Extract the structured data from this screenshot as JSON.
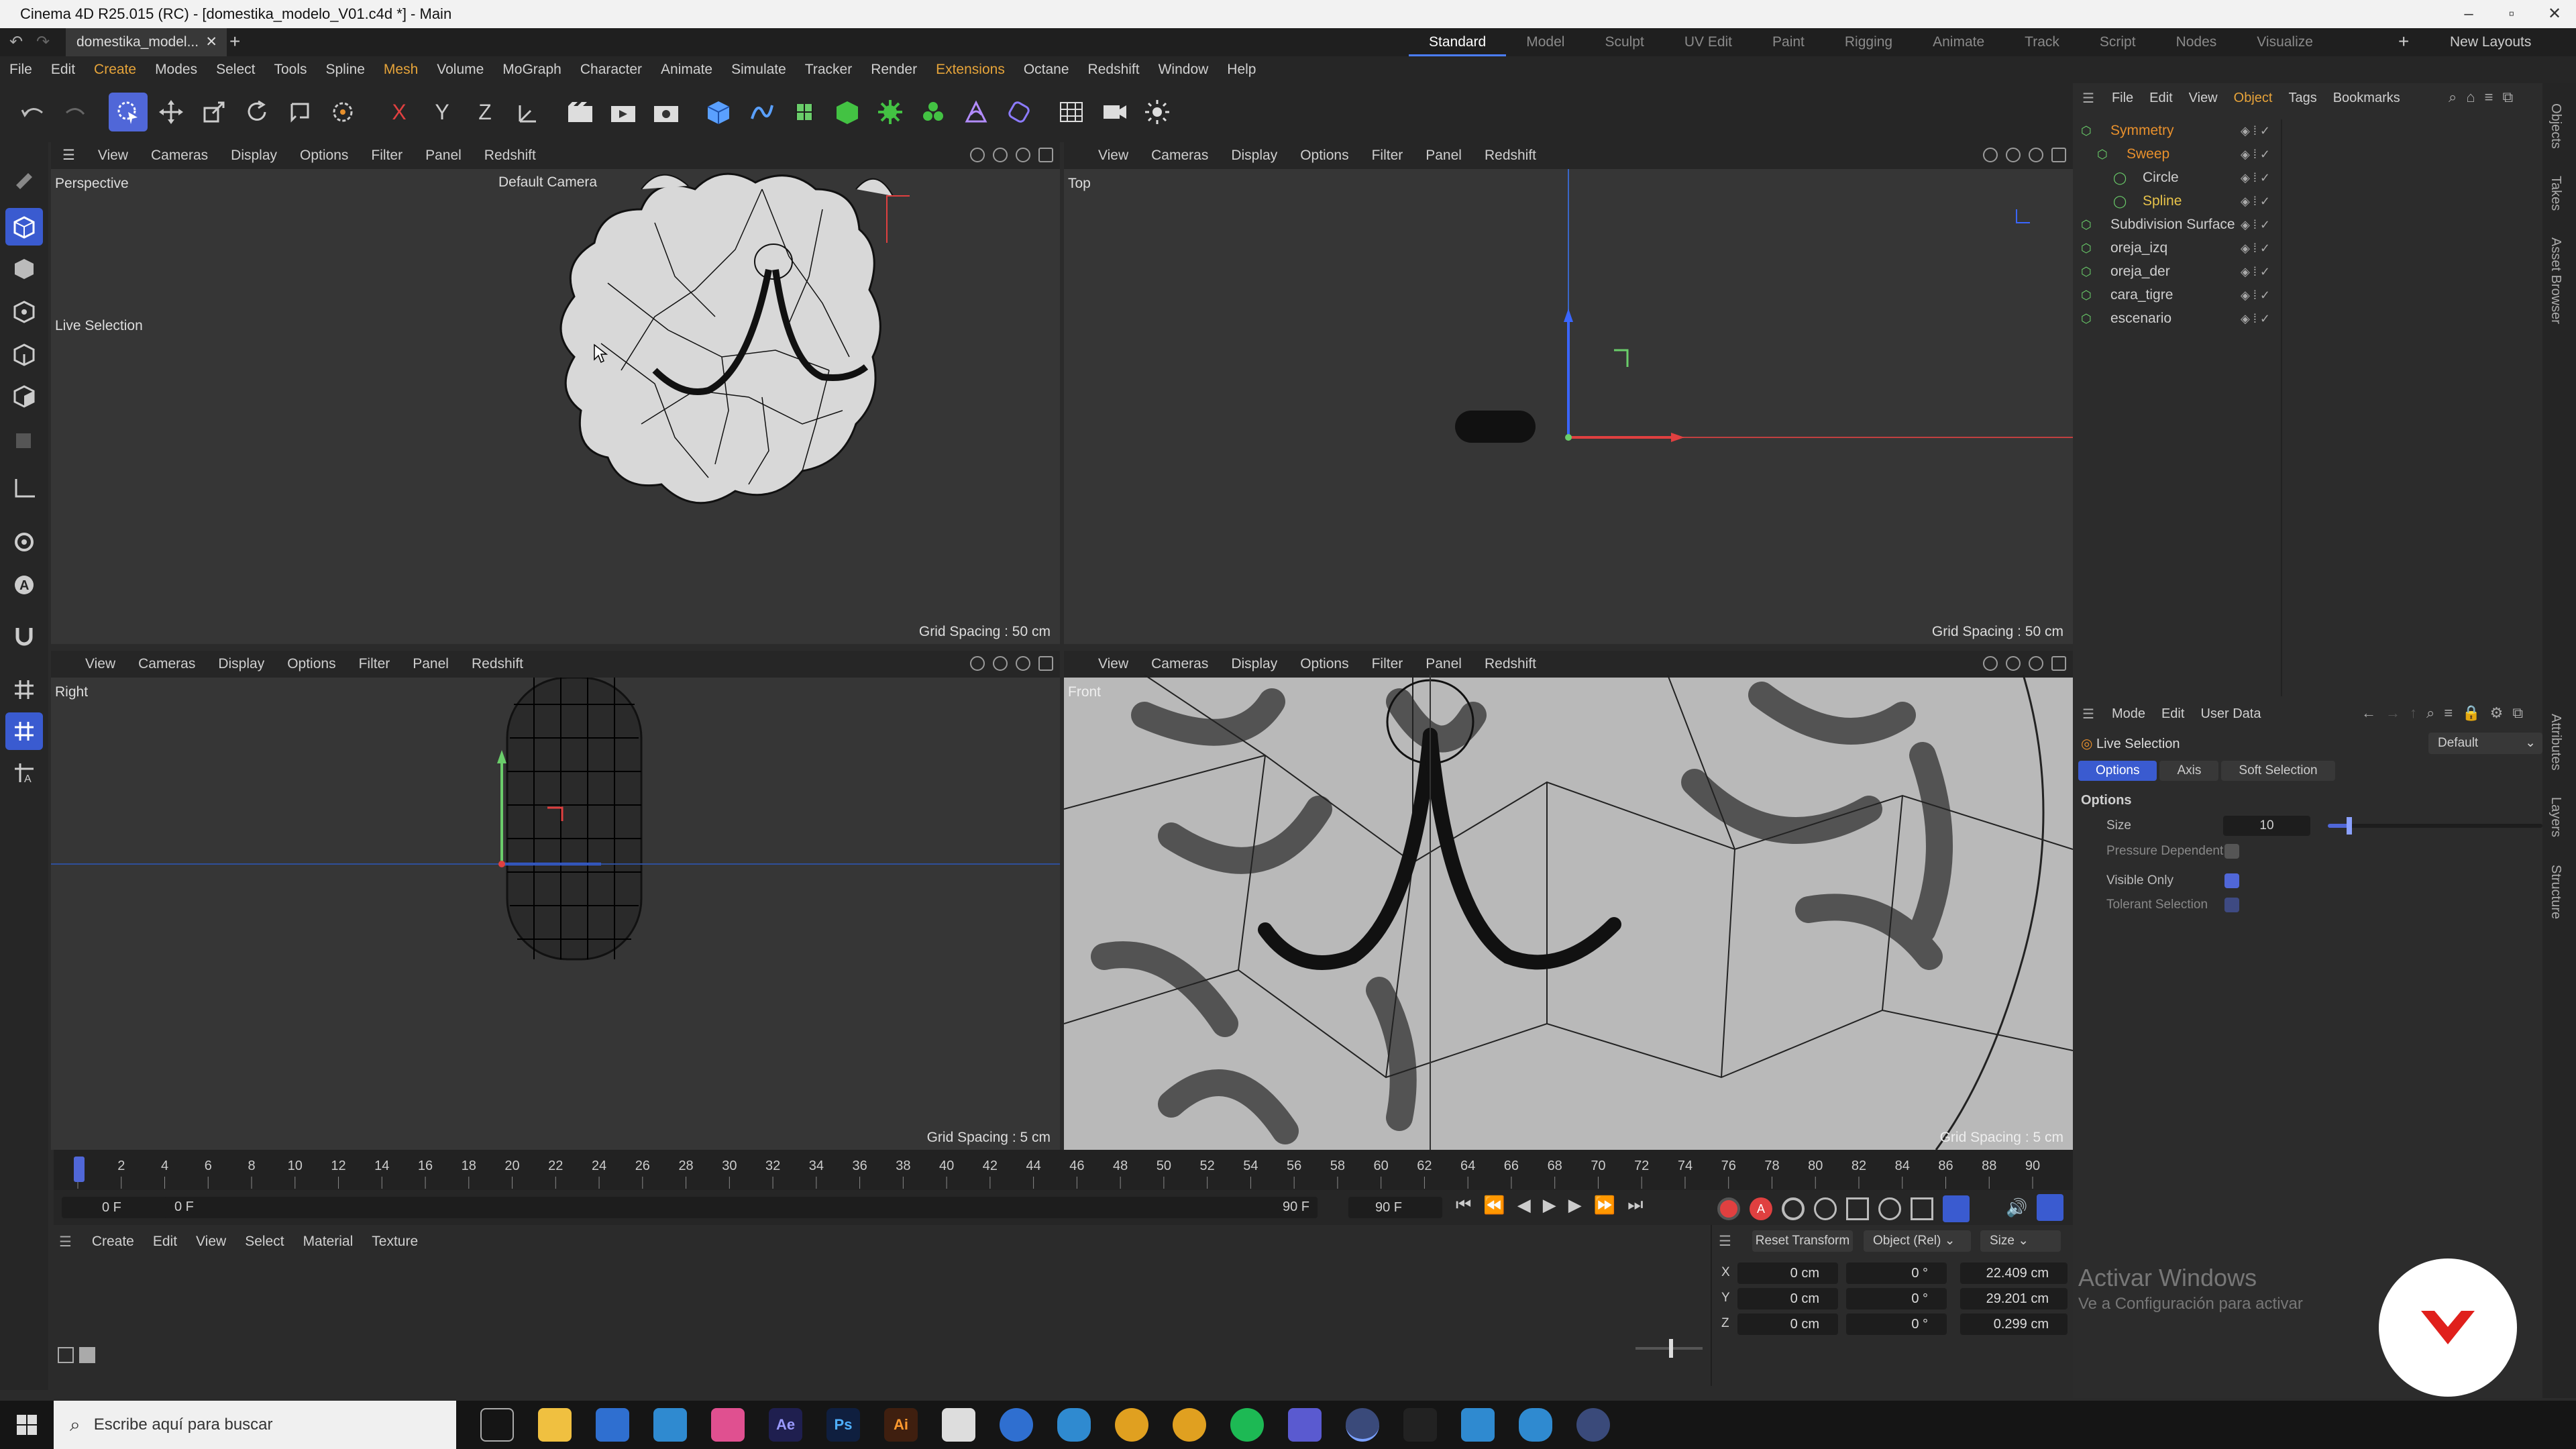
{
  "window": {
    "title": "Cinema 4D R25.015 (RC) - [domestika_modelo_V01.c4d *] - Main",
    "min": "–",
    "max": "▫",
    "close": "✕"
  },
  "tab": {
    "file": "domestika_model...",
    "close": "✕",
    "add": "+"
  },
  "layouts": [
    "Standard",
    "Model",
    "Sculpt",
    "UV Edit",
    "Paint",
    "Rigging",
    "Animate",
    "Track",
    "Script",
    "Nodes",
    "Visualize"
  ],
  "new_layouts": "New Layouts",
  "menu": [
    "File",
    "Edit",
    "Create",
    "Modes",
    "Select",
    "Tools",
    "Spline",
    "Mesh",
    "Volume",
    "MoGraph",
    "Character",
    "Animate",
    "Simulate",
    "Tracker",
    "Render",
    "Extensions",
    "Octane",
    "Redshift",
    "Window",
    "Help"
  ],
  "toolbar": {
    "axes": [
      "X",
      "Y",
      "Z"
    ]
  },
  "vp_menu": [
    "View",
    "Cameras",
    "Display",
    "Options",
    "Filter",
    "Panel",
    "Redshift"
  ],
  "viewports": {
    "perspective": {
      "label": "Perspective",
      "camera": "Default Camera",
      "grid": "Grid Spacing : 50 cm",
      "live": "Live Selection"
    },
    "top": {
      "label": "Top",
      "grid": "Grid Spacing : 50 cm"
    },
    "right": {
      "label": "Right",
      "grid": "Grid Spacing : 5 cm"
    },
    "front": {
      "label": "Front",
      "grid": "Grid Spacing : 5 cm"
    }
  },
  "timeline": {
    "ticks": [
      "0",
      "2",
      "4",
      "6",
      "8",
      "10",
      "12",
      "14",
      "16",
      "18",
      "20",
      "22",
      "24",
      "26",
      "28",
      "30",
      "32",
      "34",
      "36",
      "38",
      "40",
      "42",
      "44",
      "46",
      "48",
      "50",
      "52",
      "54",
      "56",
      "58",
      "60",
      "62",
      "64",
      "66",
      "68",
      "70",
      "72",
      "74",
      "76",
      "78",
      "80",
      "82",
      "84",
      "86",
      "88",
      "90"
    ],
    "current": "0 F",
    "start": "0 F",
    "end_a": "90 F",
    "end_b": "90 F"
  },
  "material_menu": [
    "Create",
    "Edit",
    "View",
    "Select",
    "Material",
    "Texture"
  ],
  "coords": {
    "reset": "Reset Transform",
    "mode": "Object (Rel)",
    "size_mode": "Size",
    "rows": [
      {
        "axis": "X",
        "pos": "0 cm",
        "rot": "0 °",
        "size": "22.409 cm"
      },
      {
        "axis": "Y",
        "pos": "0 cm",
        "rot": "0 °",
        "size": "29.201 cm"
      },
      {
        "axis": "Z",
        "pos": "0 cm",
        "rot": "0 °",
        "size": "0.299 cm"
      }
    ]
  },
  "objects": {
    "menu": [
      "File",
      "Edit",
      "View",
      "Object",
      "Tags",
      "Bookmarks"
    ],
    "items": [
      {
        "name": "Symmetry",
        "level": 0,
        "color": "#e8902c"
      },
      {
        "name": "Sweep",
        "level": 1,
        "color": "#e8902c"
      },
      {
        "name": "Circle",
        "level": 2,
        "color": "#cfcfcf"
      },
      {
        "name": "Spline",
        "level": 2,
        "color": "#e8c34a"
      },
      {
        "name": "Subdivision Surface",
        "level": 0,
        "color": "#cfcfcf"
      },
      {
        "name": "oreja_izq",
        "level": 0,
        "color": "#cfcfcf"
      },
      {
        "name": "oreja_der",
        "level": 0,
        "color": "#cfcfcf"
      },
      {
        "name": "cara_tigre",
        "level": 0,
        "color": "#cfcfcf"
      },
      {
        "name": "escenario",
        "level": 0,
        "color": "#cfcfcf"
      }
    ]
  },
  "side_tabs": [
    "Objects",
    "Takes",
    "Asset Browser"
  ],
  "side_tabs_lower": [
    "Attributes",
    "Layers",
    "Structure"
  ],
  "attributes": {
    "menu": [
      "Mode",
      "Edit",
      "User Data"
    ],
    "tool": "Live Selection",
    "preset": "Default",
    "tabs": [
      "Options",
      "Axis",
      "Soft Selection"
    ],
    "section": "Options",
    "size_label": "Size",
    "size_value": "10",
    "size_fraction": 0.1,
    "pressure": "Pressure Dependent",
    "visible_only": "Visible Only",
    "tolerant": "Tolerant Selection"
  },
  "watermark": {
    "line1": "Activar Windows",
    "line2": "Ve a Configuración para activar"
  },
  "taskbar": {
    "search": "Escribe aquí para buscar"
  }
}
